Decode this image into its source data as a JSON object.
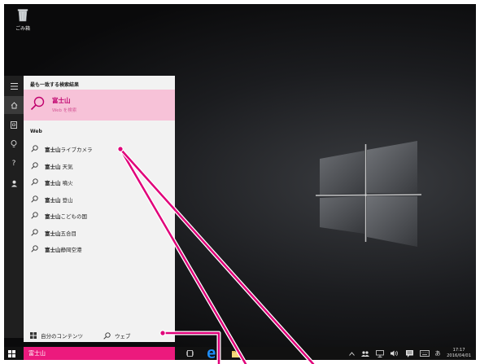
{
  "desktop": {
    "recycle_bin_label": "ごみ箱"
  },
  "search_panel": {
    "best_match_header": "最も一致する検索結果",
    "best_match": {
      "title": "富士山",
      "subtitle": "Web を検索"
    },
    "web_header": "Web",
    "suggestions": [
      {
        "bold": "富士山",
        "rest": "ライブカメラ"
      },
      {
        "bold": "富士山",
        "rest": " 天気"
      },
      {
        "bold": "富士山",
        "rest": " 噴火"
      },
      {
        "bold": "富士山",
        "rest": " 登山"
      },
      {
        "bold": "富士山",
        "rest": "こどもの国"
      },
      {
        "bold": "富士山",
        "rest": "五合目"
      },
      {
        "bold": "富士山",
        "rest": "静岡空港"
      }
    ],
    "filters": {
      "my_content": "自分のコンテンツ",
      "web": "ウェブ"
    }
  },
  "taskbar": {
    "search_value": "富士山",
    "ime_mode": "あ",
    "time": "17:17",
    "date": "2016/04/01"
  },
  "colors": {
    "accent": "#ec1a7d",
    "best_match_bg": "#f7c2d8",
    "panel_bg": "#f2f2f2",
    "annotation": "#e0007a"
  }
}
